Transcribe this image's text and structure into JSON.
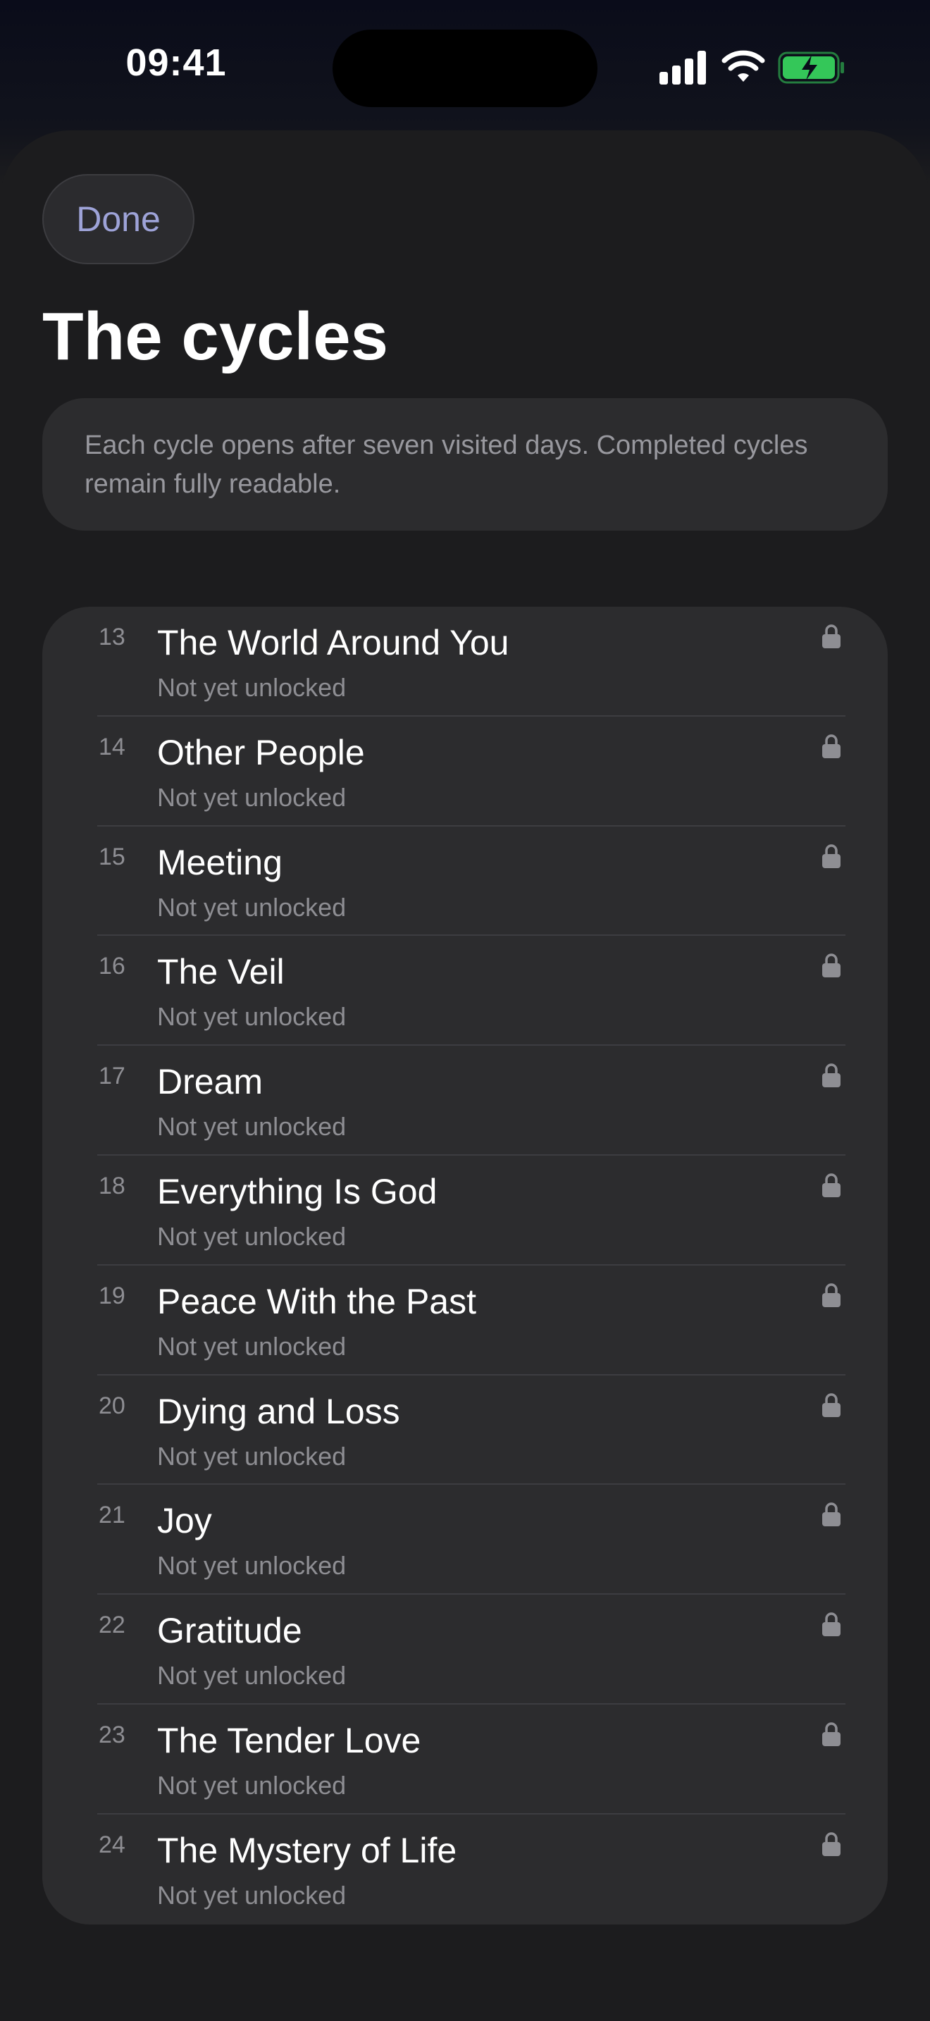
{
  "status_bar": {
    "time": "09:41",
    "icons": [
      "cellular-signal-icon",
      "wifi-icon",
      "battery-charging-icon"
    ],
    "battery_color": "#34c759"
  },
  "header": {
    "done_label": "Done",
    "title": "The cycles"
  },
  "info": {
    "text": "Each cycle opens after seven visited days. Completed cycles remain fully readable."
  },
  "colors": {
    "accent": "#9ea3d8",
    "background": "#1c1c1e",
    "card": "#2c2c2e"
  },
  "cycles": [
    {
      "number": "13",
      "title": "The World Around You",
      "status": "Not yet unlocked",
      "icon": "lock-icon"
    },
    {
      "number": "14",
      "title": "Other People",
      "status": "Not yet unlocked",
      "icon": "lock-icon"
    },
    {
      "number": "15",
      "title": "Meeting",
      "status": "Not yet unlocked",
      "icon": "lock-icon"
    },
    {
      "number": "16",
      "title": "The Veil",
      "status": "Not yet unlocked",
      "icon": "lock-icon"
    },
    {
      "number": "17",
      "title": "Dream",
      "status": "Not yet unlocked",
      "icon": "lock-icon"
    },
    {
      "number": "18",
      "title": "Everything Is God",
      "status": "Not yet unlocked",
      "icon": "lock-icon"
    },
    {
      "number": "19",
      "title": "Peace With the Past",
      "status": "Not yet unlocked",
      "icon": "lock-icon"
    },
    {
      "number": "20",
      "title": "Dying and Loss",
      "status": "Not yet unlocked",
      "icon": "lock-icon"
    },
    {
      "number": "21",
      "title": "Joy",
      "status": "Not yet unlocked",
      "icon": "lock-icon"
    },
    {
      "number": "22",
      "title": "Gratitude",
      "status": "Not yet unlocked",
      "icon": "lock-icon"
    },
    {
      "number": "23",
      "title": "The Tender Love",
      "status": "Not yet unlocked",
      "icon": "lock-icon"
    },
    {
      "number": "24",
      "title": "The Mystery of Life",
      "status": "Not yet unlocked",
      "icon": "lock-icon"
    }
  ]
}
